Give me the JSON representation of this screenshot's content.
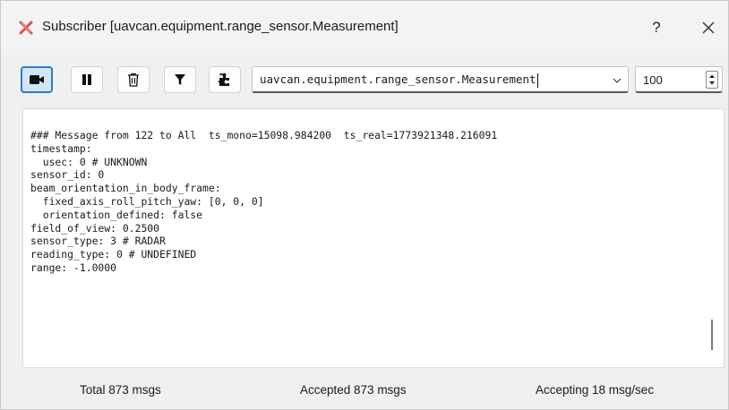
{
  "window": {
    "title": "Subscriber [uavcan.equipment.range_sensor.Measurement]",
    "help_label": "?",
    "close_icon": "close-icon",
    "app_icon": "x-logo-icon",
    "accent_color": "#2a7bd0",
    "app_icon_color": "#d9534f"
  },
  "toolbar": {
    "buttons": [
      {
        "name": "record-button",
        "icon": "video-camera-icon",
        "active": true
      },
      {
        "name": "pause-button",
        "icon": "pause-icon",
        "active": false
      },
      {
        "name": "clear-button",
        "icon": "trash-icon",
        "active": false
      },
      {
        "name": "filter-button",
        "icon": "filter-icon",
        "active": false
      },
      {
        "name": "plugin-button",
        "icon": "puzzle-icon",
        "active": false
      }
    ],
    "message_type": "uavcan.equipment.range_sensor.Measurement",
    "count_value": "100"
  },
  "output": {
    "lines": [
      "### Message from 122 to All  ts_mono=15098.984200  ts_real=1773921348.216091",
      "timestamp:",
      "  usec: 0 # UNKNOWN",
      "sensor_id: 0",
      "beam_orientation_in_body_frame:",
      "  fixed_axis_roll_pitch_yaw: [0, 0, 0]",
      "  orientation_defined: false",
      "field_of_view: 0.2500",
      "sensor_type: 3 # RADAR",
      "reading_type: 0 # UNDEFINED",
      "range: -1.0000"
    ]
  },
  "status": {
    "total": "Total 873 msgs",
    "accepted": "Accepted 873 msgs",
    "rate": "Accepting 18 msg/sec"
  }
}
